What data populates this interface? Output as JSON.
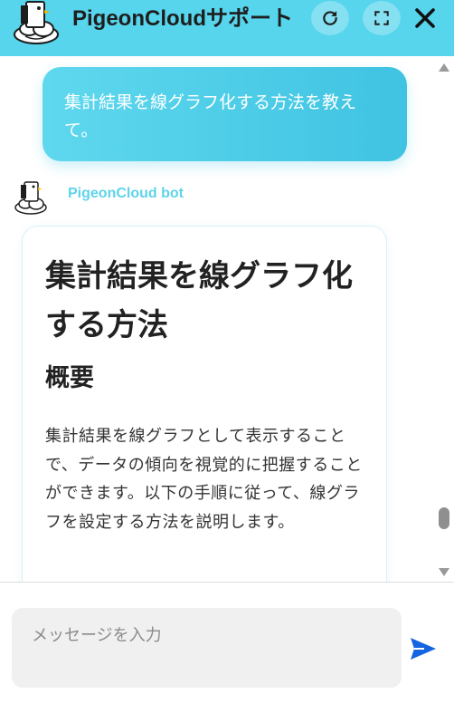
{
  "header": {
    "title": "PigeonCloudサポート",
    "background": "#56d5ec",
    "logo_icon": "pigeon-cloud-logo-icon",
    "refresh_icon": "refresh-icon",
    "expand_icon": "expand-icon",
    "close_icon": "close-icon"
  },
  "chat": {
    "user_message": "集計結果を線グラフ化する方法を教えて。",
    "bot_name": "PigeonCloud bot",
    "bot_avatar_icon": "pigeon-bot-avatar-icon",
    "bot_message": {
      "heading1": "集計結果を線グラフ化する方法",
      "heading2": "概要",
      "paragraph": "集計結果を線グラフとして表示することで、データの傾向を視覚的に把握することができます。以下の手順に従って、線グラフを設定する方法を説明します。"
    }
  },
  "input": {
    "placeholder": "メッセージを入力",
    "value": ""
  },
  "send_icon": "send-icon",
  "colors": {
    "accent": "#56d5ec",
    "bot_name": "#5ed3ea",
    "send": "#1565e0"
  }
}
